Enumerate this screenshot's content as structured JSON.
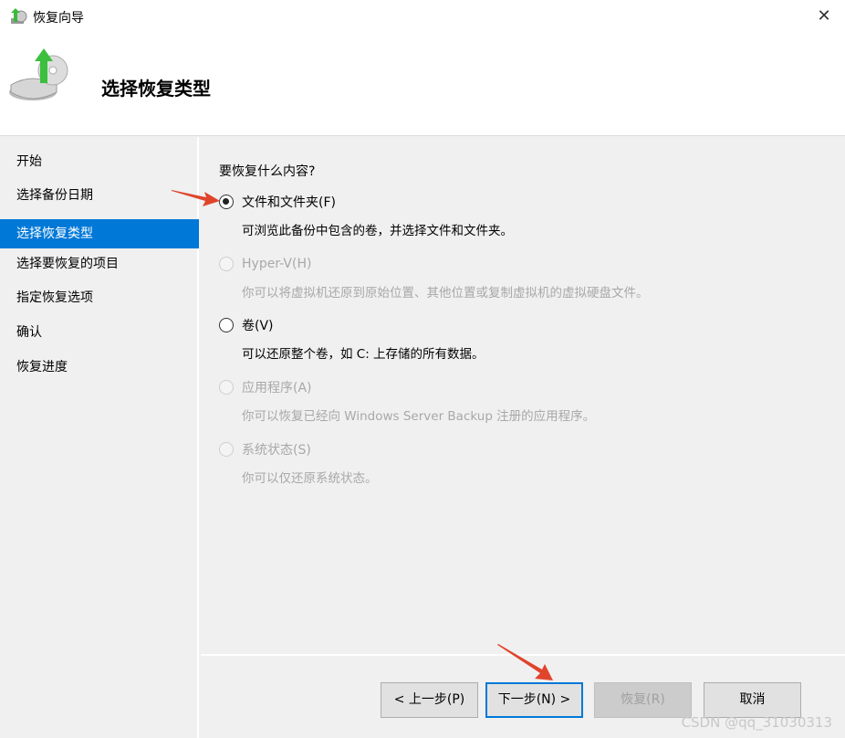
{
  "window": {
    "title": "恢复向导",
    "close_icon": "close-icon"
  },
  "header": {
    "title": "选择恢复类型"
  },
  "sidebar": {
    "items": [
      {
        "label": "开始"
      },
      {
        "label": "选择备份日期"
      },
      {
        "label": "选择恢复类型",
        "active": true
      },
      {
        "label": "选择要恢复的项目"
      },
      {
        "label": "指定恢复选项"
      },
      {
        "label": "确认"
      },
      {
        "label": "恢复进度"
      }
    ]
  },
  "content": {
    "question": "要恢复什么内容?",
    "options": [
      {
        "label": "文件和文件夹(F)",
        "desc": "可浏览此备份中包含的卷，并选择文件和文件夹。",
        "checked": true,
        "enabled": true
      },
      {
        "label": "Hyper-V(H)",
        "desc": "你可以将虚拟机还原到原始位置、其他位置或复制虚拟机的虚拟硬盘文件。",
        "checked": false,
        "enabled": false
      },
      {
        "label": "卷(V)",
        "desc": "可以还原整个卷，如 C: 上存储的所有数据。",
        "checked": false,
        "enabled": true
      },
      {
        "label": "应用程序(A)",
        "desc": "你可以恢复已经向 Windows Server Backup 注册的应用程序。",
        "checked": false,
        "enabled": false
      },
      {
        "label": "系统状态(S)",
        "desc": "你可以仅还原系统状态。",
        "checked": false,
        "enabled": false
      }
    ]
  },
  "buttons": {
    "prev": "< 上一步(P)",
    "next": "下一步(N) >",
    "restore": "恢复(R)",
    "cancel": "取消"
  },
  "watermark": "CSDN @qq_31030313",
  "colors": {
    "accent": "#0078d7",
    "annotation": "#e0442c"
  }
}
